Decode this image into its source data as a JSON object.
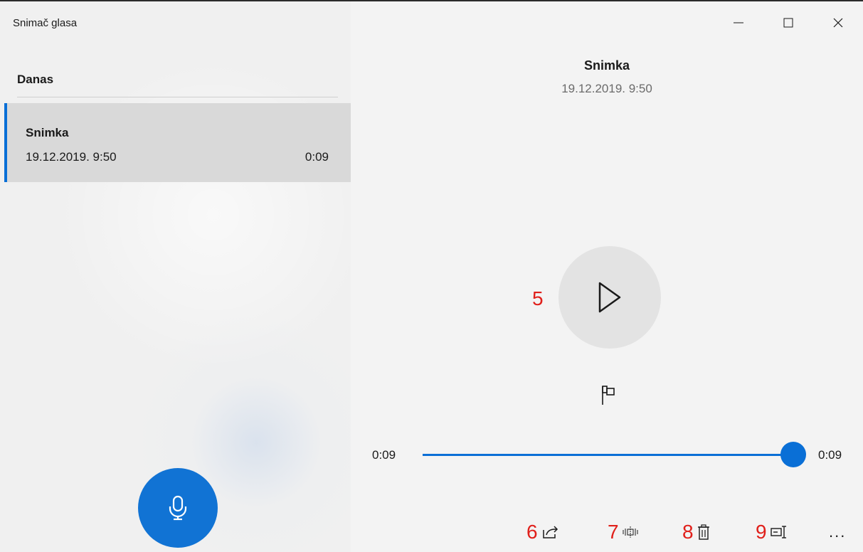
{
  "app": {
    "title": "Snimač glasa"
  },
  "window_controls": {
    "minimize_icon": "minimize-icon",
    "maximize_icon": "maximize-icon",
    "close_icon": "close-icon"
  },
  "sidebar": {
    "section_header": "Danas",
    "recordings": [
      {
        "title": "Snimka",
        "date": "19.12.2019. 9:50",
        "duration": "0:09",
        "selected": true
      }
    ],
    "record_icon": "microphone-icon"
  },
  "player": {
    "title": "Snimka",
    "date": "19.12.2019. 9:50",
    "current_time": "0:09",
    "total_time": "0:09",
    "progress": 1.0,
    "play_icon": "play-icon",
    "marker_icon": "flag-icon"
  },
  "annotations": {
    "play": "5",
    "share": "6",
    "trim": "7",
    "delete": "8",
    "rename": "9"
  },
  "toolbar": {
    "share_icon": "share-icon",
    "trim_icon": "trim-icon",
    "delete_icon": "trash-icon",
    "rename_icon": "rename-icon",
    "more_label": "..."
  },
  "colors": {
    "accent": "#0a6fd6",
    "record_button": "#1173d4",
    "annotation": "#e0201b",
    "selected_item": "#d9d9d9"
  }
}
